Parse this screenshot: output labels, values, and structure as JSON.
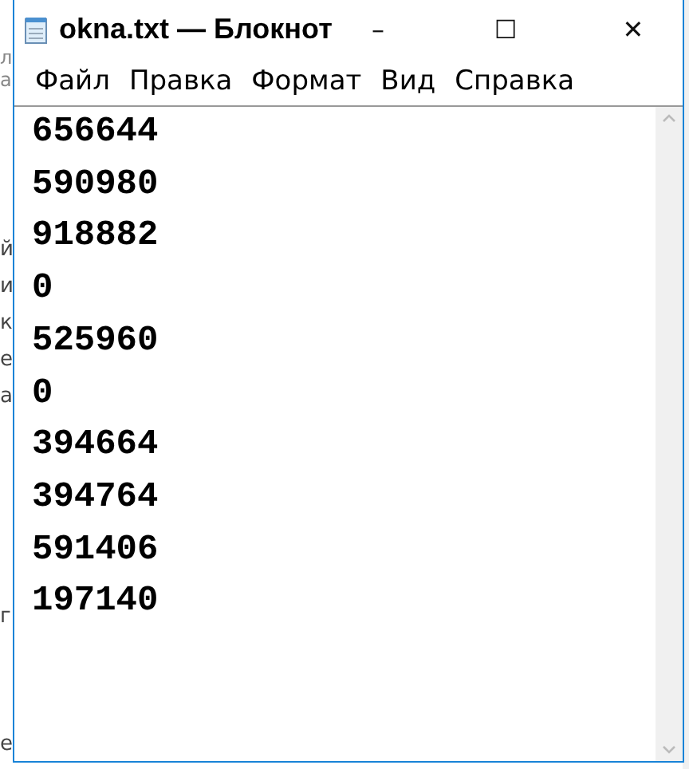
{
  "background_window": {
    "fragments": [
      "л",
      "а",
      "й",
      "и",
      "к",
      "е",
      "а",
      "г",
      "е"
    ]
  },
  "window": {
    "title": "okna.txt — Блокнот",
    "controls": [
      "–",
      "☐",
      "✕"
    ]
  },
  "menu": [
    "Файл",
    "Правка",
    "Формат",
    "Вид",
    "Справка"
  ],
  "editor": {
    "lines": [
      "656644",
      "590980",
      "918882",
      "0",
      "525960",
      "0",
      "394664",
      "394764",
      "591406",
      "197140"
    ]
  }
}
